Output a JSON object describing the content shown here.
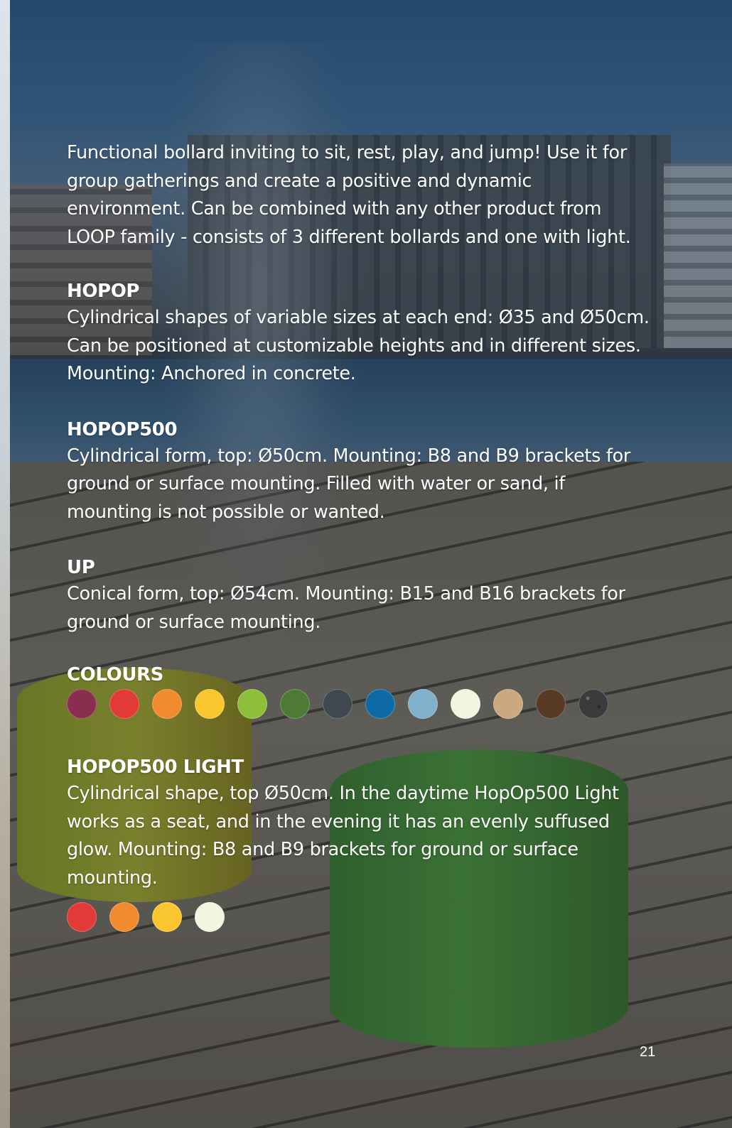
{
  "intro": "Functional bollard inviting to sit, rest, play, and jump! Use it for group gatherings and create a positive and dynamic environment. Can be combined with any other product from LOOP family - consists of 3 different bollards and one with light.",
  "sections": [
    {
      "heading": "HOPOP",
      "text": "Cylindrical shapes of variable sizes at each end: Ø35 and Ø50cm. Can be positioned at customizable heights and in different sizes. Mounting: Anchored in concrete."
    },
    {
      "heading": "HOPOP500",
      "text": "Cylindrical form, top: Ø50cm. Mounting: B8 and B9 brackets for ground or surface mounting. Filled with water or sand, if mounting is not possible or wanted."
    },
    {
      "heading": "UP",
      "text": "Conical form, top: Ø54cm. Mounting: B15 and B16 brackets for ground or surface mounting."
    }
  ],
  "colours": {
    "heading": "COLOURS",
    "swatches": [
      "#8a2e50",
      "#e23a36",
      "#f28a2e",
      "#f9c62d",
      "#8dbf3a",
      "#4f7a35",
      "#3f4751",
      "#0e6aa5",
      "#7fb0cc",
      "#f2f5df",
      "#c9a97d",
      "#573b24",
      "#3b3b3e"
    ]
  },
  "light": {
    "heading": "HOPOP500 LIGHT",
    "text": "Cylindrical shape, top Ø50cm. In the daytime HopOp500 Light works as a seat, and in the evening it has an evenly suffused glow. Mounting: B8 and B9 brackets for ground or surface mounting.",
    "swatches": [
      "#e23a36",
      "#f28a2e",
      "#f9c62d",
      "#f2f5df"
    ]
  },
  "page_number": "21"
}
